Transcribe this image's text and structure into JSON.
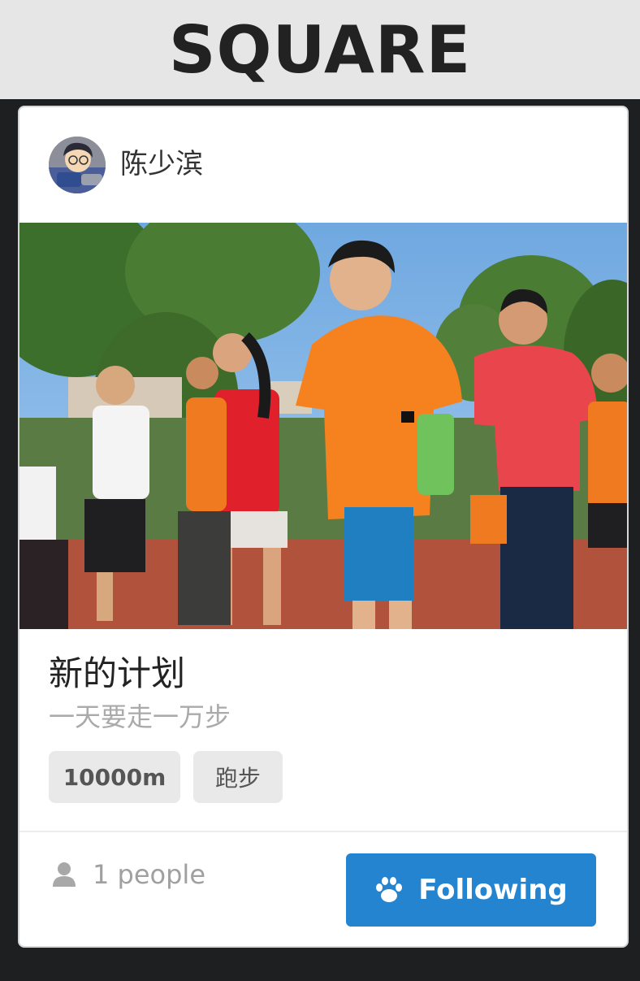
{
  "app": {
    "title": "SQUARE"
  },
  "post": {
    "author": {
      "name": "陈少滨",
      "avatar_icon": "cartoon-avatar-icon"
    },
    "photo": {
      "description_icon": "photo-runners"
    },
    "title": "新的计划",
    "subtitle": "一天要走一万步",
    "tags": [
      "10000m",
      "跑步"
    ],
    "participants": {
      "icon": "user-icon",
      "label": "1 people"
    },
    "follow_button": {
      "icon": "paw-icon",
      "label": "Following",
      "color": "#2584d0"
    }
  }
}
